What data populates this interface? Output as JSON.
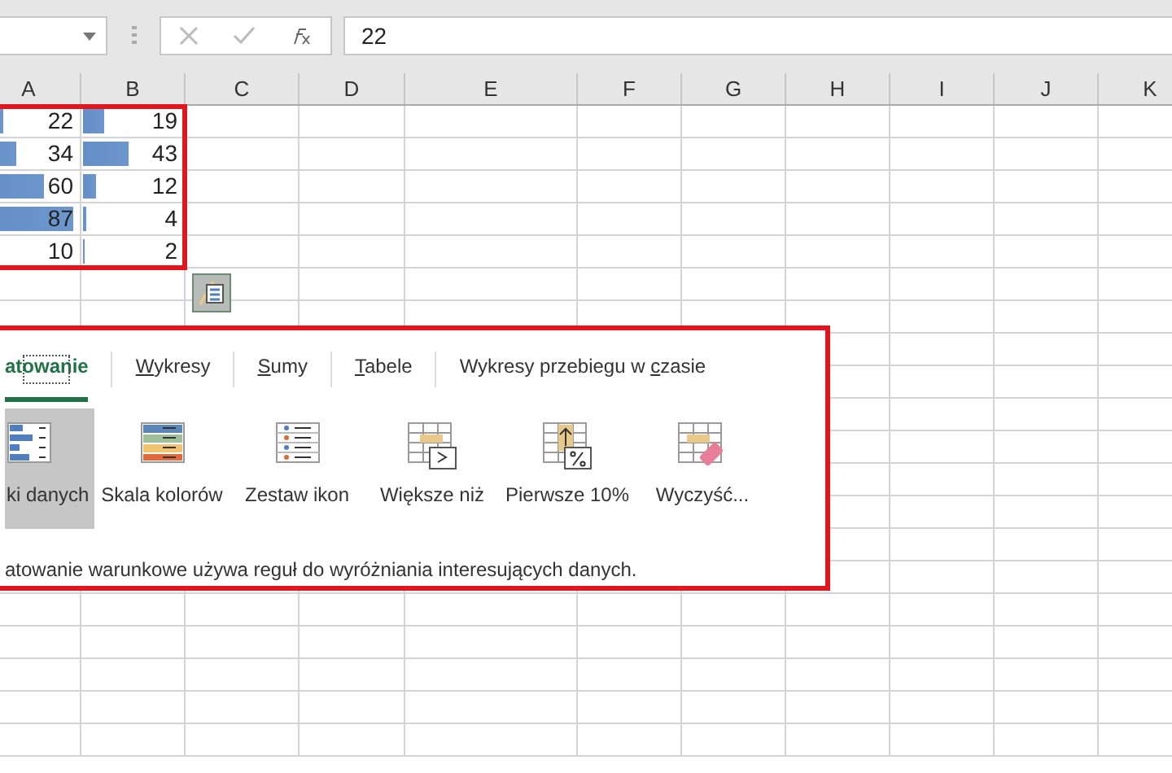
{
  "formula_bar": {
    "value": "22"
  },
  "columns": [
    "A",
    "B",
    "C",
    "D",
    "E",
    "F",
    "G",
    "H",
    "I",
    "J",
    "K"
  ],
  "rows": [
    {
      "cells": [
        {
          "value": "22",
          "level": 0.25
        },
        {
          "value": "19",
          "level": 0.22
        }
      ]
    },
    {
      "cells": [
        {
          "value": "34",
          "level": 0.39
        },
        {
          "value": "43",
          "level": 0.47
        }
      ]
    },
    {
      "cells": [
        {
          "value": "60",
          "level": 0.67
        },
        {
          "value": "12",
          "level": 0.13
        }
      ]
    },
    {
      "cells": [
        {
          "value": "87",
          "level": 0.97
        },
        {
          "value": "4",
          "level": 0.04
        }
      ]
    },
    {
      "cells": [
        {
          "value": "10"
        },
        {
          "value": "2",
          "level": 0.02
        }
      ]
    }
  ],
  "quick_analysis": {
    "tabs": [
      {
        "label_parts": [
          {
            "text": "atowanie",
            "underlined": false
          }
        ],
        "selected": true
      },
      {
        "label_parts": [
          {
            "text": "W",
            "underlined": true
          },
          {
            "text": "ykresy",
            "underlined": false
          }
        ],
        "selected": false
      },
      {
        "label_parts": [
          {
            "text": "S",
            "underlined": true
          },
          {
            "text": "umy",
            "underlined": false
          }
        ],
        "selected": false
      },
      {
        "label_parts": [
          {
            "text": "T",
            "underlined": true
          },
          {
            "text": "abele",
            "underlined": false
          }
        ],
        "selected": false
      },
      {
        "label_parts": [
          {
            "text": "Wykresy przebiegu w ",
            "underlined": false
          },
          {
            "text": "c",
            "underlined": true
          },
          {
            "text": "zasie",
            "underlined": false
          }
        ],
        "selected": false
      }
    ],
    "items": [
      {
        "kind": "data_bars",
        "label": "ki danych",
        "selected": true
      },
      {
        "kind": "color_scale",
        "label": "Skala kolorów",
        "selected": false
      },
      {
        "kind": "icon_set",
        "label": "Zestaw ikon",
        "selected": false
      },
      {
        "kind": "greater_than",
        "label": "Większe niż",
        "selected": false
      },
      {
        "kind": "top_percent",
        "label": "Pierwsze 10%",
        "selected": false
      },
      {
        "kind": "clear",
        "label": "Wyczyść...",
        "selected": false
      }
    ],
    "description": "atowanie warunkowe używa reguł do wyróżniania interesujących danych."
  }
}
